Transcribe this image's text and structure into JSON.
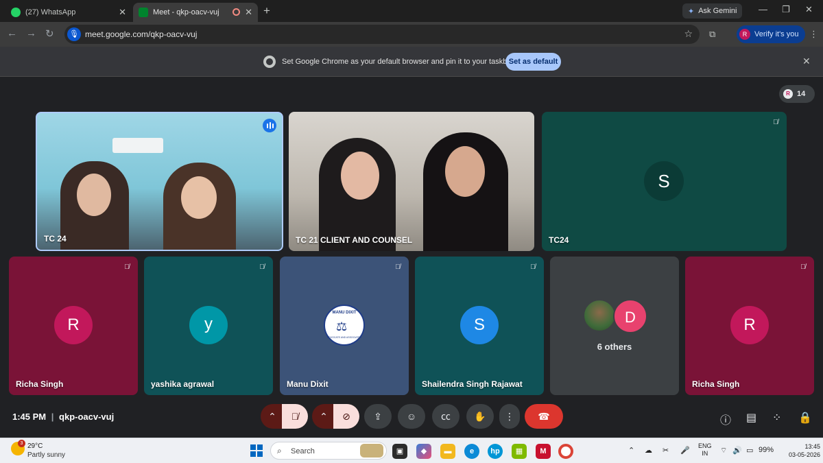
{
  "browser": {
    "tabs": [
      {
        "title": "(27) WhatsApp",
        "favicon": "whatsapp-icon"
      },
      {
        "title": "Meet - qkp-oacv-vuj",
        "favicon": "meet-icon",
        "active": true
      }
    ],
    "ask_gemini": "Ask Gemini",
    "url": "meet.google.com/qkp-oacv-vuj",
    "verify_label": "Verify it's you",
    "profile_initial": "R"
  },
  "banner": {
    "message": "Set Google Chrome as your default browser and pin it to your taskbar",
    "button": "Set as default"
  },
  "meet": {
    "participant_count": "14",
    "count_avatar": "R",
    "top_tiles": [
      {
        "name": "TC 24",
        "speaking": true
      },
      {
        "name": "TC 21 CLIENT AND COUNSEL",
        "muted": false
      },
      {
        "name": "TC24",
        "avatar": "S",
        "muted": true
      }
    ],
    "bottom_tiles": [
      {
        "name": "Richa Singh",
        "avatar": "R"
      },
      {
        "name": "yashika agrawal",
        "avatar": "y"
      },
      {
        "name": "Manu Dixit",
        "logo_top": "MANU DIXIT",
        "logo_bottom": "ADVOCATE AND ASSOCIATES"
      },
      {
        "name": "Shailendra Singh Rajawat",
        "avatar": "S"
      },
      {
        "name": "6 others",
        "avatar": "D"
      },
      {
        "name": "Richa Singh",
        "avatar": "R"
      }
    ],
    "time": "1:45 PM",
    "meeting_code": "qkp-oacv-vuj"
  },
  "taskbar": {
    "temperature": "29°C",
    "condition": "Partly sunny",
    "weather_badge": "3",
    "search": "Search",
    "lang_top": "ENG",
    "lang_bottom": "IN",
    "battery": "99%",
    "clock_time": "13:45",
    "clock_date": "03-05-2026"
  },
  "colors": {
    "tile_pink": "#7a1337",
    "tile_teal": "#0f5257",
    "tile_blue": "#3c5378",
    "avatar_pink": "#c2185b",
    "avatar_teal": "#0097a7",
    "avatar_blue": "#1e88e5",
    "end_call": "#dc362e"
  }
}
